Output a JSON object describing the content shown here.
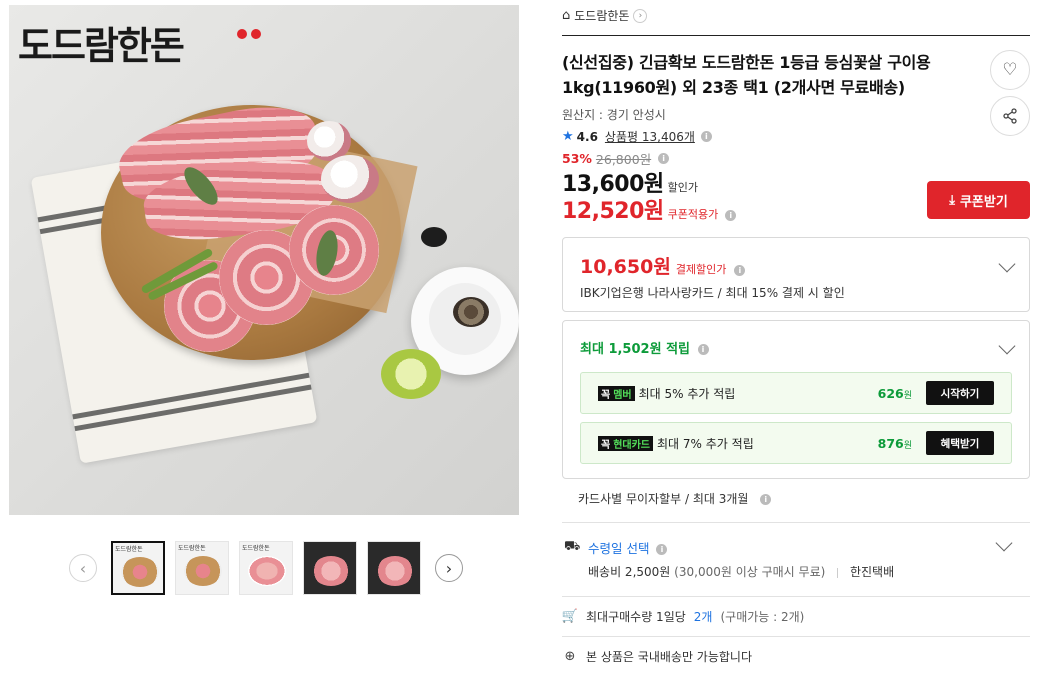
{
  "brand": {
    "logo_text": "도드람한돈"
  },
  "gallery": {
    "thumb_labels": [
      "도드람한돈",
      "도드람한돈",
      "도드람한돈"
    ],
    "prev_icon": "chevron-left-icon",
    "next_icon": "chevron-right-icon"
  },
  "breadcrumb": {
    "label": "도드람한돈"
  },
  "product": {
    "title": "(신선집중) 긴급확보 도드람한돈 1등급 등심꽃살 구이용 1kg(11960원) 외 23종 택1 (2개사면 무료배송)",
    "origin": "원산지 : 경기 안성시",
    "rating": "4.6",
    "review_label": "상품평 13,406개",
    "discount_pct": "53%",
    "original_price": "26,800원",
    "sale_price": "13,600원",
    "sale_label": "할인가",
    "coupon_price": "12,520원",
    "coupon_label": "쿠폰적용가",
    "coupon_button": "쿠폰받기"
  },
  "payment": {
    "price": "10,650원",
    "label": "결제할인가",
    "card_desc": "IBK기업은행 나라사랑카드 / 최대 15% 결제 시 할인"
  },
  "rewards": {
    "title_prefix": "최대",
    "amount": "1,502원",
    "title_suffix": "적립",
    "rows": [
      {
        "tag_a": "꼭",
        "tag_b": "멤버",
        "desc": "최대 5% 추가 적립",
        "amount": "626",
        "unit": "원",
        "button": "시작하기"
      },
      {
        "tag_a": "꼭",
        "tag_b": "현대카드",
        "desc": "최대 7% 추가 적립",
        "amount": "876",
        "unit": "원",
        "button": "혜택받기"
      }
    ]
  },
  "installment": "카드사별 무이자할부 / 최대 3개월",
  "shipping": {
    "title": "수령일 선택",
    "fee": "배송비 2,500원",
    "fee_note": "(30,000원 이상 구매시 무료)",
    "carrier": "한진택배"
  },
  "max_qty": {
    "label": "최대구매수량 1일당",
    "count": "2개",
    "note": "(구매가능 : 2개)"
  },
  "domestic": "본 상품은 국내배송만 가능합니다",
  "colors": {
    "accent_red": "#e0252b",
    "reward_green": "#0d9b3a",
    "link_blue": "#1f73e0"
  }
}
